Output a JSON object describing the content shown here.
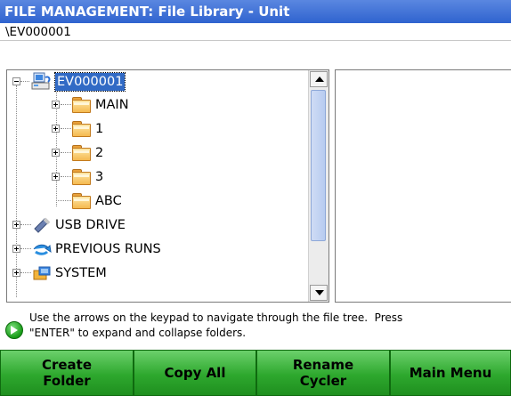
{
  "window": {
    "title": "FILE MANAGEMENT: File Library - Unit"
  },
  "path": "\\EV000001",
  "tree": {
    "items": [
      {
        "label": "EV000001",
        "icon": "unit-computer-icon",
        "expander": "minus",
        "selected": true
      },
      {
        "label": "MAIN",
        "icon": "folder-icon",
        "expander": "plus"
      },
      {
        "label": "1",
        "icon": "folder-icon",
        "expander": "plus"
      },
      {
        "label": "2",
        "icon": "folder-icon",
        "expander": "plus"
      },
      {
        "label": "3",
        "icon": "folder-icon",
        "expander": "plus"
      },
      {
        "label": "ABC",
        "icon": "folder-icon",
        "expander": "none"
      },
      {
        "label": "USB DRIVE",
        "icon": "usb-drive-icon",
        "expander": "plus"
      },
      {
        "label": "PREVIOUS RUNS",
        "icon": "previous-runs-icon",
        "expander": "plus"
      },
      {
        "label": "SYSTEM",
        "icon": "system-icon",
        "expander": "plus"
      }
    ]
  },
  "hint": {
    "line1": "Use the arrows on the keypad to navigate through the file tree.  Press",
    "line2": "\"ENTER\" to expand and collapse folders."
  },
  "buttons": {
    "create_folder": "Create\nFolder",
    "copy_all": "Copy All",
    "rename_cycler": "Rename\nCycler",
    "main_menu": "Main Menu"
  },
  "colors": {
    "title_bar": "#3a6fd8",
    "selection": "#316ac5",
    "button_green": "#2ea82e"
  }
}
